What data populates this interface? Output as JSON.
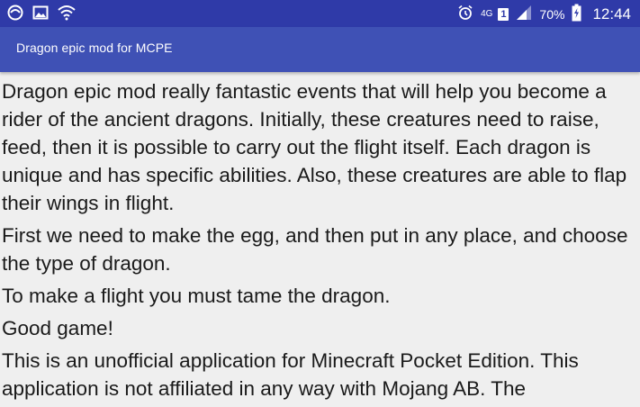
{
  "status_bar": {
    "network_type": "4G",
    "sim_slot": "1",
    "battery_percent": "70%",
    "time": "12:44",
    "icons": [
      "browser-icon",
      "gallery-icon",
      "wifi-icon",
      "alarm-icon",
      "signal-icon",
      "battery-charging-icon"
    ]
  },
  "app_bar": {
    "title": "Dragon epic mod for MCPE"
  },
  "content": {
    "paragraphs": [
      "Dragon epic mod really fantastic events that will help you become a rider of the ancient dragons. Initially, these creatures need to raise, feed, then it is possible to carry out the flight itself. Each dragon is unique and has specific abilities. Also, these creatures are able to flap their wings in flight.",
      "First we need to make the egg, and then put in any place, and choose the type of dragon.",
      "To make a flight you must tame the dragon.",
      "Good game!",
      "This is an unofficial application for Minecraft Pocket Edition. This application is not affiliated in any way with Mojang AB. The"
    ]
  },
  "colors": {
    "status_bar": "#2f3aa8",
    "app_bar": "#3f51b5",
    "background": "#efefef",
    "text": "#1a1a1a"
  }
}
